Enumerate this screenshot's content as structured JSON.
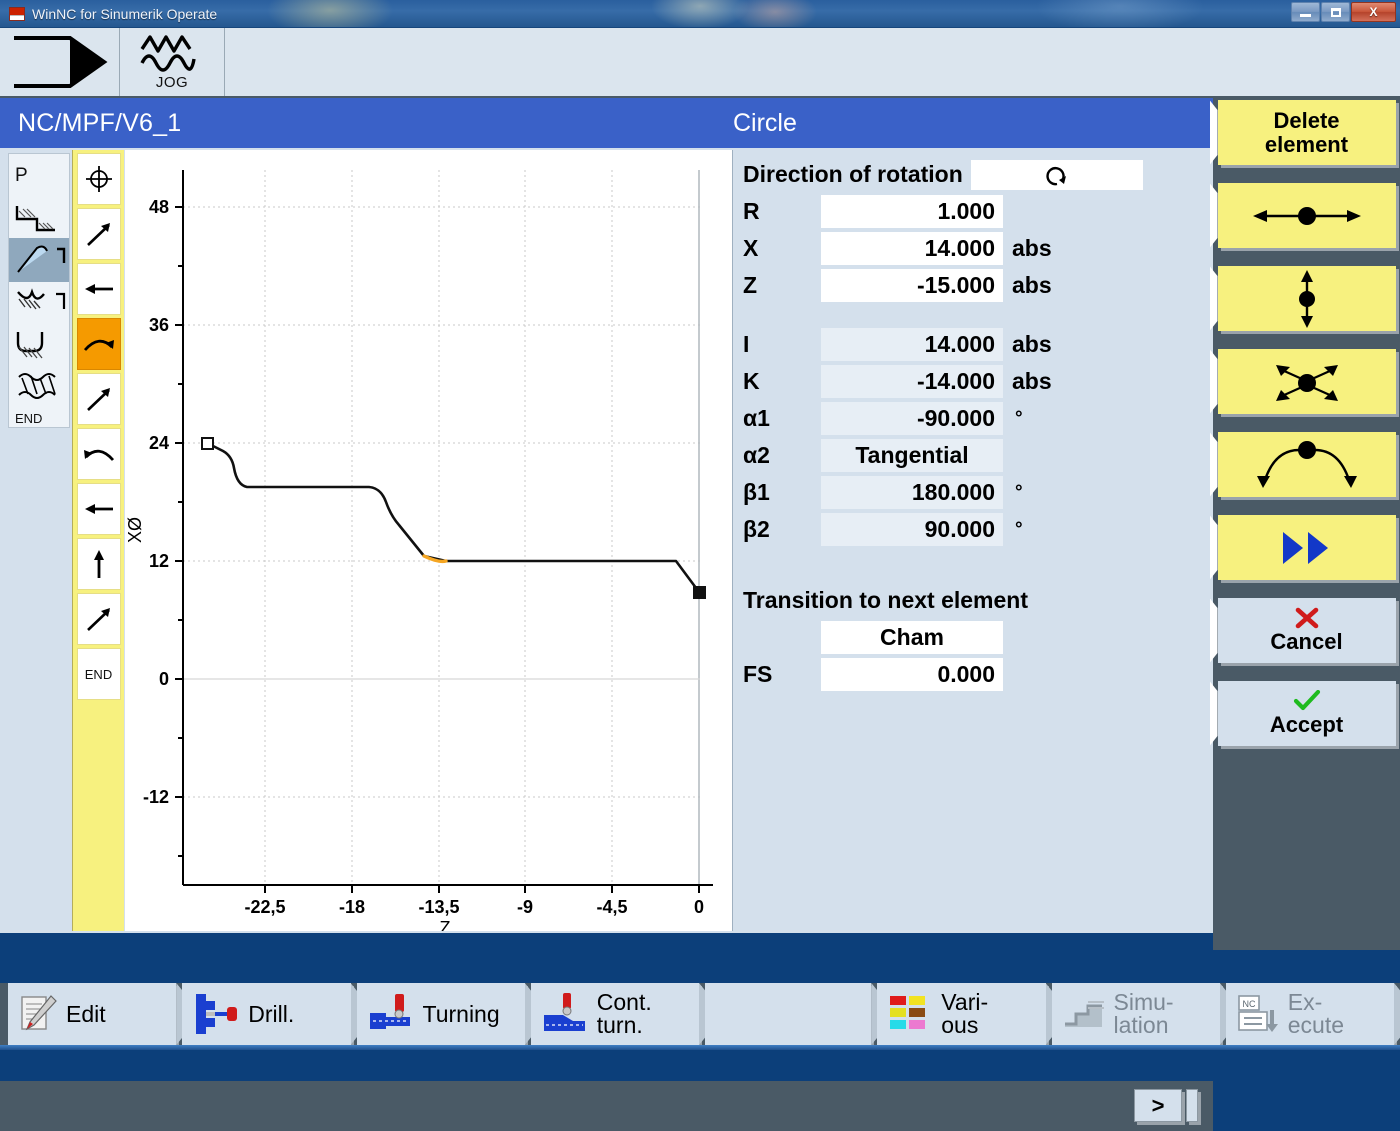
{
  "window": {
    "title": "WinNC for Sinumerik Operate",
    "app_icon": "winnc-icon",
    "minimize_label": "minimize",
    "maximize_label": "maximize",
    "close_label": "X"
  },
  "machine_header": {
    "channel_icon": "channel-arrow-icon",
    "mode_icon": "jog-wave-icon",
    "mode_label": "JOG"
  },
  "app_band": {
    "path": "NC/MPF/V6_1",
    "form_title": "Circle"
  },
  "type_column": {
    "items": [
      {
        "label": "P",
        "icon": "pole-p-icon",
        "selected": false
      },
      {
        "label": "",
        "icon": "step-contour-icon",
        "selected": false
      },
      {
        "label": "",
        "icon": "taper-blue-icon",
        "selected": true
      },
      {
        "label": "",
        "icon": "undercut-icon",
        "selected": false
      },
      {
        "label": "",
        "icon": "groove-icon",
        "selected": false
      },
      {
        "label": "",
        "icon": "thread-icon",
        "selected": false
      },
      {
        "label": "END",
        "icon": "end-label",
        "selected": false
      }
    ]
  },
  "element_strip": {
    "items": [
      {
        "icon": "start-point-crosshair-icon",
        "active": false
      },
      {
        "icon": "line-diagonal-up-icon",
        "active": false
      },
      {
        "icon": "line-left-icon",
        "active": false
      },
      {
        "icon": "arc-clockwise-icon",
        "active": true
      },
      {
        "icon": "line-diagonal-up-icon",
        "active": false
      },
      {
        "icon": "arc-counterclockwise-icon",
        "active": false
      },
      {
        "icon": "line-left-icon",
        "active": false
      },
      {
        "icon": "line-up-icon",
        "active": false
      },
      {
        "icon": "line-diagonal-up-icon",
        "active": false
      },
      {
        "icon": "end-label",
        "active": false,
        "label": "END"
      }
    ]
  },
  "form": {
    "rotation_label": "Direction of rotation",
    "rotation_icon": "rotation-clockwise-icon",
    "fields": [
      {
        "label": "R",
        "value": "1.000",
        "unit": "",
        "dim": false
      },
      {
        "label": "X",
        "value": "14.000",
        "unit": "abs",
        "dim": false
      },
      {
        "label": "Z",
        "value": "-15.000",
        "unit": "abs",
        "dim": false
      }
    ],
    "fields2": [
      {
        "label": "I",
        "value": "14.000",
        "unit": "abs",
        "dim": true
      },
      {
        "label": "K",
        "value": "-14.000",
        "unit": "abs",
        "dim": true
      },
      {
        "label": "α1",
        "value": "-90.000",
        "unit": "°",
        "dim": true
      },
      {
        "label": "α2",
        "value": "Tangential",
        "unit": "",
        "dim": true,
        "center": true
      },
      {
        "label": "β1",
        "value": "180.000",
        "unit": "°",
        "dim": true
      },
      {
        "label": "β2",
        "value": "90.000",
        "unit": "°",
        "dim": true
      }
    ],
    "transition_label": "Transition to next element",
    "transition_value": "Cham",
    "fs_label": "FS",
    "fs_value": "0.000"
  },
  "softkeys": [
    {
      "name": "delete-element",
      "label": "Delete\nelement",
      "icon": "",
      "style": "yellow"
    },
    {
      "name": "move-horizontal",
      "label": "",
      "icon": "arrows-horizontal-dot-icon",
      "style": "yellow"
    },
    {
      "name": "move-vertical",
      "label": "",
      "icon": "arrows-vertical-dot-icon",
      "style": "yellow"
    },
    {
      "name": "move-diagonal",
      "label": "",
      "icon": "arrows-diagonal-dot-icon",
      "style": "yellow"
    },
    {
      "name": "move-arc",
      "label": "",
      "icon": "arrows-arc-dot-icon",
      "style": "yellow"
    },
    {
      "name": "next-page",
      "label": "",
      "icon": "double-chevron-right-icon",
      "style": "yellow"
    },
    {
      "name": "cancel",
      "label": "Cancel",
      "icon": "red-x-icon",
      "style": "plain"
    },
    {
      "name": "accept",
      "label": "Accept",
      "icon": "green-check-icon",
      "style": "plain"
    }
  ],
  "more_key": {
    "label": ">"
  },
  "bottom_keys": [
    {
      "name": "edit",
      "label": "Edit",
      "icon": "edit-pencil-icon",
      "disabled": false
    },
    {
      "name": "drill",
      "label": "Drill.",
      "icon": "drill-icon",
      "disabled": false
    },
    {
      "name": "turning",
      "label": "Turning",
      "icon": "turning-icon",
      "disabled": false
    },
    {
      "name": "cont-turn",
      "label": "Cont.\nturn.",
      "icon": "cont-turn-icon",
      "disabled": false
    },
    {
      "name": "blank",
      "label": "",
      "icon": "",
      "disabled": false
    },
    {
      "name": "various",
      "label": "Vari-\nous",
      "icon": "various-grid-icon",
      "disabled": false
    },
    {
      "name": "simulation",
      "label": "Simu-\nlation",
      "icon": "simulation-icon",
      "disabled": true
    },
    {
      "name": "execute",
      "label": "Ex-\necute",
      "icon": "nc-execute-icon",
      "disabled": true
    }
  ],
  "chart_data": {
    "type": "line",
    "title": "",
    "xlabel": "Z",
    "ylabel": "XØ",
    "xlim": [
      -27.0,
      1.5
    ],
    "ylim": [
      -18.0,
      54.0
    ],
    "xticks": [
      "-22,5",
      "-18",
      "-13,5",
      "-9",
      "-4,5",
      "0"
    ],
    "xtick_values": [
      -22.5,
      -18,
      -13.5,
      -9,
      -4.5,
      0
    ],
    "yticks": [
      "48",
      "36",
      "24",
      "12",
      "0",
      "-12"
    ],
    "ytick_values": [
      48,
      36,
      24,
      12,
      0,
      -12
    ],
    "grid": true,
    "legend": "none",
    "series": [
      {
        "name": "contour",
        "color": "#000000",
        "points": [
          {
            "z": -25.5,
            "x": 24.0,
            "marker": "open-square"
          },
          {
            "z": -24.2,
            "x": 22.2
          },
          {
            "z": -23.6,
            "x": 20.2
          },
          {
            "z": -16.5,
            "x": 20.2
          },
          {
            "z": -15.6,
            "x": 18.4
          },
          {
            "z": -11.3,
            "x": 13.4
          },
          {
            "z": -10.2,
            "x": 12.0
          },
          {
            "z": -1.0,
            "x": 12.0
          },
          {
            "z": 0.0,
            "x": 8.6,
            "marker": "filled-square"
          }
        ]
      },
      {
        "name": "selected-arc",
        "color": "#f5a623",
        "points": [
          {
            "z": -11.3,
            "x": 13.4
          },
          {
            "z": -10.9,
            "x": 12.4
          },
          {
            "z": -10.2,
            "x": 12.0
          }
        ]
      }
    ]
  }
}
